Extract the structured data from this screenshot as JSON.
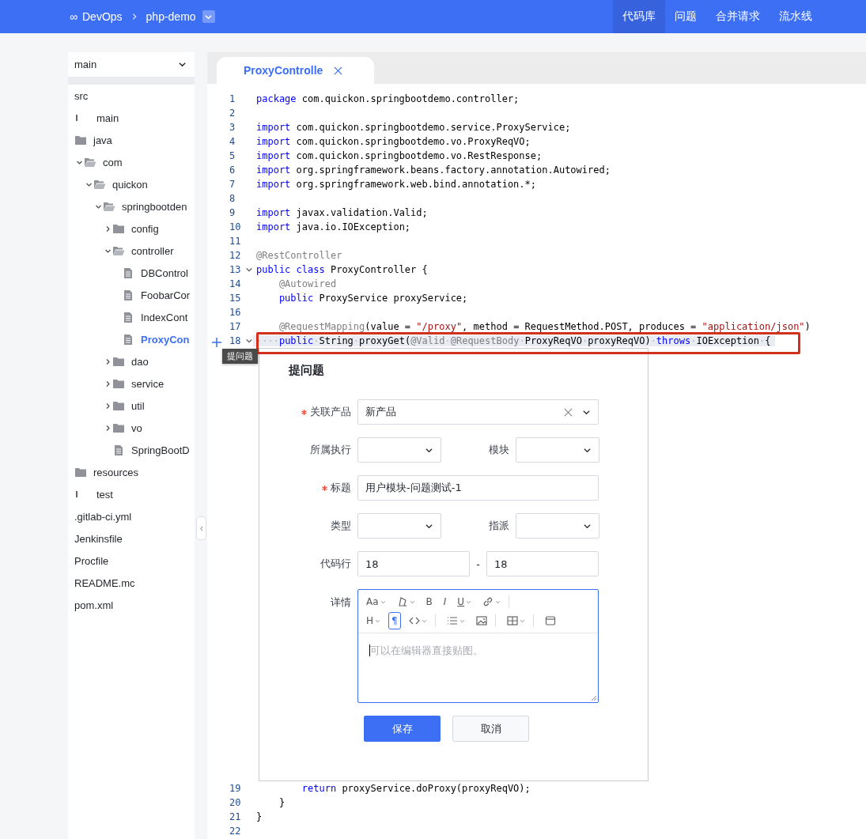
{
  "top_bar": {
    "logo": "∞",
    "breadcrumb": [
      "DevOps",
      "php-demo"
    ],
    "nav": [
      {
        "label": "代码库",
        "selected": true
      },
      {
        "label": "问题",
        "selected": false
      },
      {
        "label": "合并请求",
        "selected": false
      },
      {
        "label": "流水线",
        "selected": false
      }
    ]
  },
  "sidebar": {
    "branch": "main",
    "tree": [
      {
        "label": "src",
        "kind": "plain",
        "selected": false
      },
      {
        "label": "main",
        "kind": "stub",
        "selected": false
      },
      {
        "label": "java",
        "kind": "folder",
        "selected": false
      },
      {
        "label": "com",
        "kind": "folder",
        "expanded": true,
        "selected": false,
        "children": [
          {
            "label": "quickon",
            "kind": "folder",
            "expanded": true,
            "selected": false,
            "children": [
              {
                "label": "springbootden",
                "kind": "folder",
                "expanded": true,
                "selected": false,
                "children": [
                  {
                    "label": "config",
                    "kind": "folder",
                    "expanded": false,
                    "selected": false
                  },
                  {
                    "label": "controller",
                    "kind": "folder",
                    "expanded": true,
                    "selected": false,
                    "children": [
                      {
                        "label": "DBControl",
                        "kind": "file",
                        "selected": false
                      },
                      {
                        "label": "FoobarCor",
                        "kind": "file",
                        "selected": false
                      },
                      {
                        "label": "IndexCont",
                        "kind": "file",
                        "selected": false
                      },
                      {
                        "label": "ProxyCon",
                        "kind": "file",
                        "selected": true
                      }
                    ]
                  },
                  {
                    "label": "dao",
                    "kind": "folder",
                    "expanded": false,
                    "selected": false
                  },
                  {
                    "label": "service",
                    "kind": "folder",
                    "expanded": false,
                    "selected": false
                  },
                  {
                    "label": "util",
                    "kind": "folder",
                    "expanded": false,
                    "selected": false
                  },
                  {
                    "label": "vo",
                    "kind": "folder",
                    "expanded": false,
                    "selected": false
                  },
                  {
                    "label": "SpringBootD",
                    "kind": "file",
                    "selected": false
                  }
                ]
              }
            ]
          }
        ]
      },
      {
        "label": "resources",
        "kind": "folder",
        "selected": false
      },
      {
        "label": "test",
        "kind": "stub",
        "selected": false
      },
      {
        "label": ".gitlab-ci.yml",
        "kind": "plain",
        "selected": false
      },
      {
        "label": "Jenkinsfile",
        "kind": "plain",
        "selected": false
      },
      {
        "label": "Procfile",
        "kind": "plain",
        "selected": false
      },
      {
        "label": "README.mc",
        "kind": "plain",
        "selected": false
      },
      {
        "label": "pom.xml",
        "kind": "plain",
        "selected": false
      }
    ]
  },
  "editor": {
    "tabs": [
      {
        "label": "ProxyControlle",
        "selected": true
      }
    ],
    "lines_before": [
      {
        "number": "1",
        "tokens": [
          {
            "kind": "kw",
            "text": "package"
          },
          {
            "kind": "plain",
            "text": " com.quickon.springbootdemo.controller;"
          }
        ]
      },
      {
        "number": "2"
      },
      {
        "number": "3",
        "tokens": [
          {
            "kind": "kw",
            "text": "import"
          },
          {
            "kind": "plain",
            "text": " com.quickon.springbootdemo.service.ProxyService;"
          }
        ]
      },
      {
        "number": "4",
        "tokens": [
          {
            "kind": "kw",
            "text": "import"
          },
          {
            "kind": "plain",
            "text": " com.quickon.springbootdemo.vo.ProxyReqVO;"
          }
        ]
      },
      {
        "number": "5",
        "tokens": [
          {
            "kind": "kw",
            "text": "import"
          },
          {
            "kind": "plain",
            "text": " com.quickon.springbootdemo.vo.RestResponse;"
          }
        ]
      },
      {
        "number": "6",
        "tokens": [
          {
            "kind": "kw",
            "text": "import"
          },
          {
            "kind": "plain",
            "text": " org.springframework.beans.factory.annotation.Autowired;"
          }
        ]
      },
      {
        "number": "7",
        "tokens": [
          {
            "kind": "kw",
            "text": "import"
          },
          {
            "kind": "plain",
            "text": " org.springframework.web.bind.annotation.*;"
          }
        ]
      },
      {
        "number": "8"
      },
      {
        "number": "9",
        "tokens": [
          {
            "kind": "kw",
            "text": "import"
          },
          {
            "kind": "plain",
            "text": " javax.validation.Valid;"
          }
        ]
      },
      {
        "number": "10",
        "tokens": [
          {
            "kind": "kw",
            "text": "import"
          },
          {
            "kind": "plain",
            "text": " java.io.IOException;"
          }
        ]
      },
      {
        "number": "11"
      },
      {
        "number": "12",
        "tokens": [
          {
            "kind": "ann",
            "text": "@RestController"
          }
        ]
      },
      {
        "number": "13",
        "folded": false,
        "tokens": [
          {
            "kind": "kw",
            "text": "public class"
          },
          {
            "kind": "plain",
            "text": " ProxyController {"
          }
        ]
      },
      {
        "number": "14",
        "tokens": [
          {
            "kind": "ann",
            "text": "    @Autowired"
          }
        ]
      },
      {
        "number": "15",
        "tokens": [
          {
            "kind": "kw",
            "text": "    public"
          },
          {
            "kind": "plain",
            "text": " ProxyService proxyService;"
          }
        ]
      },
      {
        "number": "16"
      },
      {
        "number": "17",
        "tokens": [
          {
            "kind": "ann",
            "text": "    @RequestMapping"
          },
          {
            "kind": "plain",
            "text": "(value = "
          },
          {
            "kind": "str",
            "text": "\"/proxy\""
          },
          {
            "kind": "plain",
            "text": ", method = RequestMethod.POST, produces = "
          },
          {
            "kind": "str",
            "text": "\"application/json\""
          },
          {
            "kind": "plain",
            "text": ")"
          }
        ]
      },
      {
        "number": "18",
        "folded": false,
        "marked": true,
        "tokens": [
          {
            "kind": "ws",
            "text": "····"
          },
          {
            "kind": "kw",
            "text": "public"
          },
          {
            "kind": "ws",
            "text": "·"
          },
          {
            "kind": "plain",
            "text": "String"
          },
          {
            "kind": "ws",
            "text": "·"
          },
          {
            "kind": "plain",
            "text": "proxyGet("
          },
          {
            "kind": "ann",
            "text": "@Valid"
          },
          {
            "kind": "ws",
            "text": "·"
          },
          {
            "kind": "ann",
            "text": "@RequestBody"
          },
          {
            "kind": "ws",
            "text": "·"
          },
          {
            "kind": "plain",
            "text": "ProxyReqVO"
          },
          {
            "kind": "ws",
            "text": "·"
          },
          {
            "kind": "plain",
            "text": "proxyReqVO)"
          },
          {
            "kind": "ws",
            "text": "·"
          },
          {
            "kind": "kw",
            "text": "throws"
          },
          {
            "kind": "ws",
            "text": "·"
          },
          {
            "kind": "plain",
            "text": "IOException"
          },
          {
            "kind": "ws",
            "text": "·"
          },
          {
            "kind": "plain",
            "text": "{"
          }
        ]
      }
    ],
    "tooltip": "提问题",
    "issue_form": {
      "title": "提问题",
      "rows": [
        [
          {
            "kind": "select",
            "label": "关联产品",
            "required": true,
            "value": "新产品",
            "clearable": true
          }
        ],
        [
          {
            "kind": "select",
            "label": "所属执行",
            "required": false
          },
          {
            "kind": "select",
            "label": "模块",
            "required": false
          }
        ],
        [
          {
            "kind": "text",
            "label": "标题",
            "required": true,
            "value": "用户模块-问题测试-1"
          }
        ],
        [
          {
            "kind": "select",
            "label": "类型",
            "required": false
          },
          {
            "kind": "select",
            "label": "指派",
            "required": false
          }
        ],
        [
          {
            "kind": "range",
            "label": "代码行",
            "required": false,
            "from": "18",
            "separator": "-",
            "to": "18"
          }
        ],
        [
          {
            "kind": "editor",
            "label": "详情",
            "required": false,
            "placeholder": "可以在编辑器直接贴图。",
            "toolbar": [
              [
                {
                  "kind": "text",
                  "label": "Aa",
                  "dropdown": true,
                  "selected": false
                },
                {
                  "kind": "color",
                  "dropdown": true,
                  "selected": false
                },
                {
                  "kind": "text",
                  "label": "B",
                  "dropdown": false,
                  "selected": false
                },
                {
                  "kind": "italic",
                  "label": "I",
                  "dropdown": false,
                  "selected": false
                },
                {
                  "kind": "underline",
                  "label": "U",
                  "dropdown": true,
                  "selected": false
                },
                {
                  "kind": "link",
                  "dropdown": true,
                  "selected": false
                },
                {
                  "kind": "divider"
                }
              ],
              [
                {
                  "kind": "text",
                  "label": "H",
                  "dropdown": true,
                  "selected": false
                },
                {
                  "kind": "text",
                  "label": "¶",
                  "dropdown": false,
                  "selected": true
                },
                {
                  "kind": "code",
                  "dropdown": true,
                  "selected": false
                },
                {
                  "kind": "divider"
                },
                {
                  "kind": "list",
                  "dropdown": true,
                  "selected": false
                },
                {
                  "kind": "image",
                  "dropdown": false,
                  "selected": false
                },
                {
                  "kind": "divider"
                },
                {
                  "kind": "table",
                  "dropdown": true,
                  "selected": false
                },
                {
                  "kind": "divider"
                },
                {
                  "kind": "fullscreen",
                  "dropdown": false,
                  "selected": false
                }
              ]
            ]
          }
        ]
      ],
      "buttons": [
        {
          "label": "保存",
          "primary": true
        },
        {
          "label": "取消",
          "primary": false
        }
      ]
    },
    "lines_after": [
      {
        "number": "19",
        "tokens": [
          {
            "kind": "kw",
            "text": "        return"
          },
          {
            "kind": "plain",
            "text": " proxyService.doProxy(proxyReqVO);"
          }
        ]
      },
      {
        "number": "20",
        "tokens": [
          {
            "kind": "plain",
            "text": "    }"
          }
        ]
      },
      {
        "number": "21",
        "tokens": [
          {
            "kind": "plain",
            "text": "}"
          }
        ]
      },
      {
        "number": "22"
      }
    ]
  }
}
